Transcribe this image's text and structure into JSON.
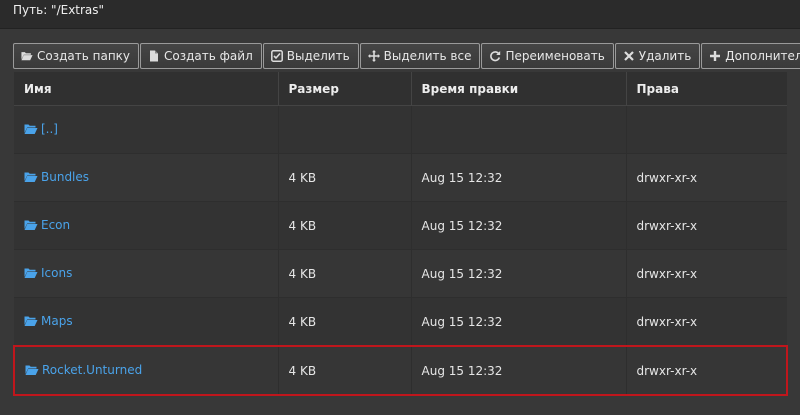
{
  "path": {
    "text": "Путь: \"/Extras\""
  },
  "toolbar": {
    "buttons": [
      {
        "label": "Создать папку",
        "icon": "folder-open-icon"
      },
      {
        "label": "Создать файл",
        "icon": "file-icon"
      },
      {
        "label": "Выделить",
        "icon": "check-square-icon"
      },
      {
        "label": "Выделить все",
        "icon": "move-icon"
      },
      {
        "label": "Переименовать",
        "icon": "refresh-icon"
      },
      {
        "label": "Удалить",
        "icon": "close-icon"
      },
      {
        "label": "Дополнительно",
        "icon": "plus-icon"
      }
    ]
  },
  "table": {
    "headers": [
      "Имя",
      "Размер",
      "Время правки",
      "Права"
    ],
    "rows": [
      {
        "name": "[..]",
        "size": "",
        "modified": "",
        "perms": ""
      },
      {
        "name": "Bundles",
        "size": "4 KB",
        "modified": "Aug 15 12:32",
        "perms": "drwxr-xr-x"
      },
      {
        "name": "Econ",
        "size": "4 KB",
        "modified": "Aug 15 12:32",
        "perms": "drwxr-xr-x"
      },
      {
        "name": "Icons",
        "size": "4 KB",
        "modified": "Aug 15 12:32",
        "perms": "drwxr-xr-x"
      },
      {
        "name": "Maps",
        "size": "4 KB",
        "modified": "Aug 15 12:32",
        "perms": "drwxr-xr-x"
      },
      {
        "name": "Rocket.Unturned",
        "size": "4 KB",
        "modified": "Aug 15 12:32",
        "perms": "drwxr-xr-x"
      }
    ]
  },
  "colors": {
    "link": "#4aa3ea",
    "highlight": "#c0161c",
    "background": "#383838"
  }
}
